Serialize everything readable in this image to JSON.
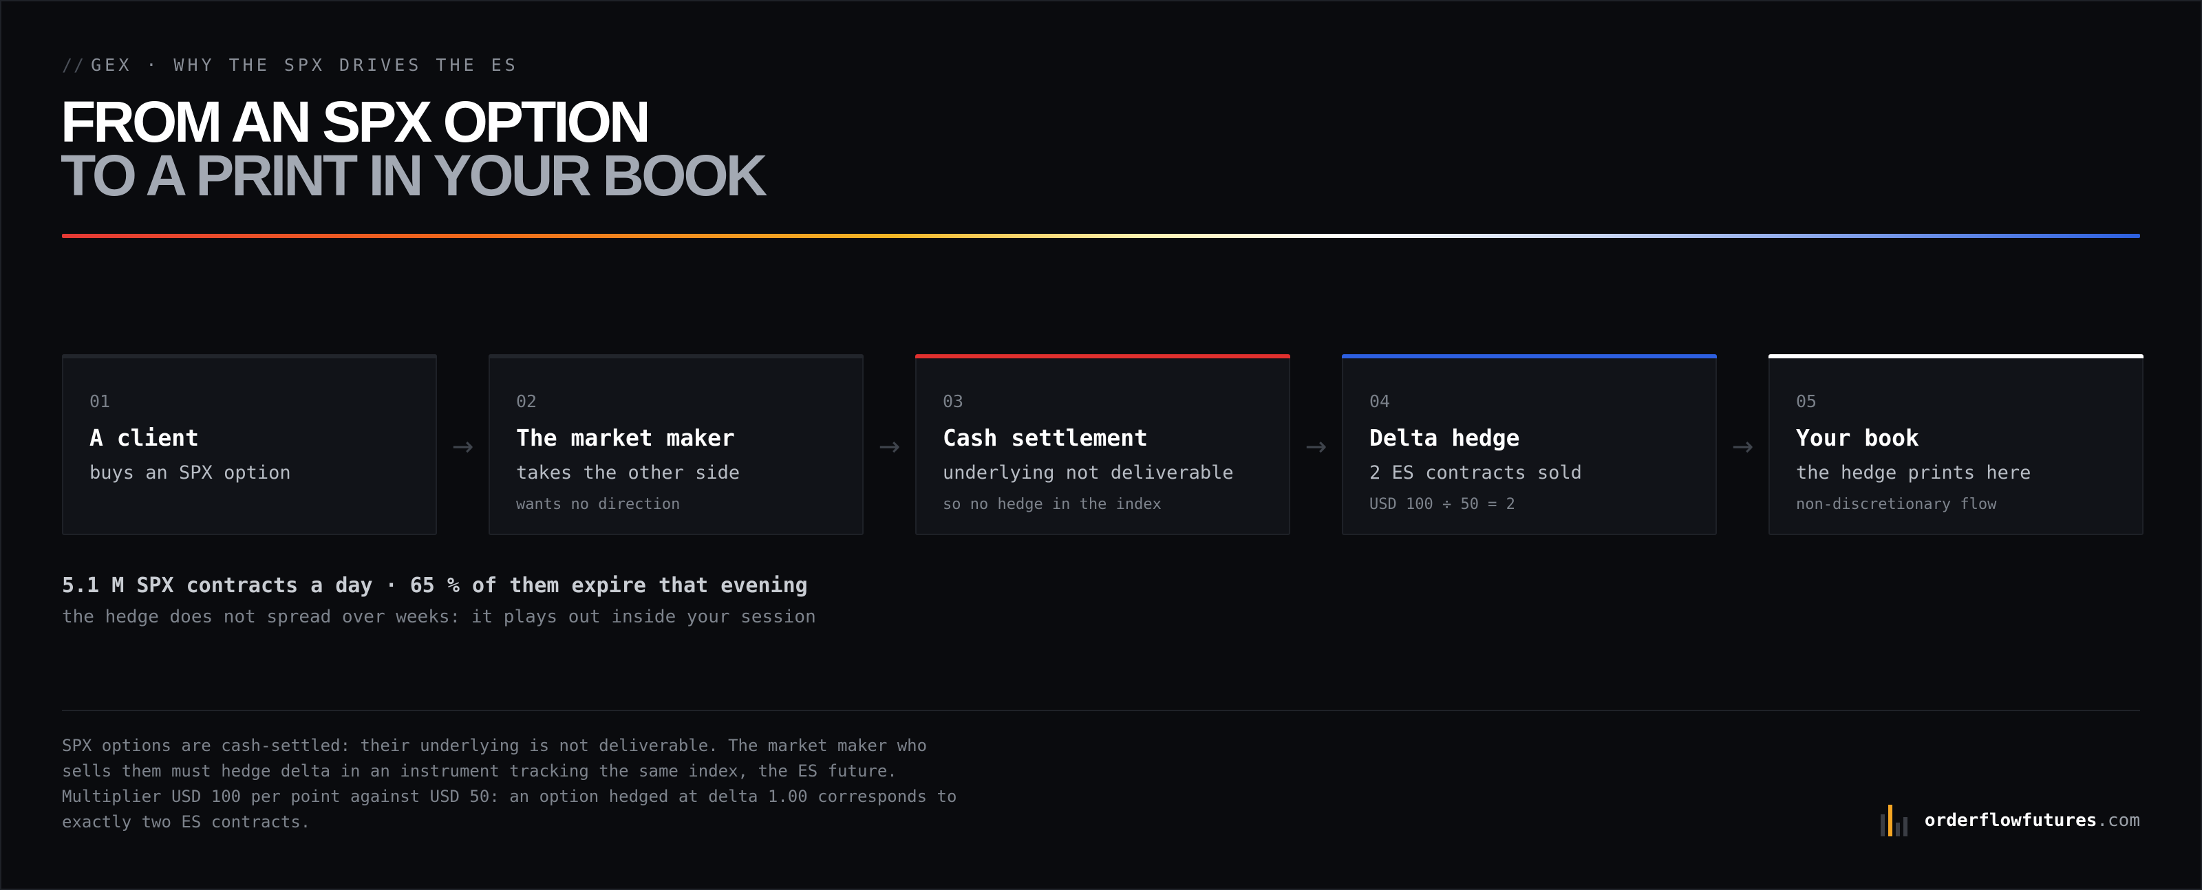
{
  "header": {
    "eyebrow_prefix": "//",
    "eyebrow": "GEX · WHY THE SPX DRIVES THE ES",
    "title_line1": "FROM AN SPX OPTION",
    "title_line2": "TO A PRINT IN YOUR BOOK",
    "rule_colors": [
      "#e53935",
      "#f06a1a",
      "#f3b625",
      "#ffffff",
      "#2c5fde"
    ]
  },
  "steps": [
    {
      "num": "01",
      "title": "A client",
      "subtitle": "buys an SPX option",
      "note": "",
      "accent": "#22252b"
    },
    {
      "num": "02",
      "title": "The market maker",
      "subtitle": "takes the other side",
      "note": "wants no direction",
      "accent": "#22252b"
    },
    {
      "num": "03",
      "title": "Cash settlement",
      "subtitle": "underlying not deliverable",
      "note": "so no hedge in the index",
      "accent": "#e0302e"
    },
    {
      "num": "04",
      "title": "Delta hedge",
      "subtitle": "2 ES contracts sold",
      "note": "USD 100 ÷ 50 = 2",
      "accent": "#2d5fe0"
    },
    {
      "num": "05",
      "title": "Your book",
      "subtitle": "the hedge prints here",
      "note": "non-discretionary flow",
      "accent": "#ffffff"
    }
  ],
  "arrow_icon": "arrow-right-icon",
  "arrow_glyph": "→",
  "stats": {
    "headline": "5.1 M SPX contracts a day · 65 % of them expire that evening",
    "sub": "the hedge does not spread over weeks: it plays out inside your session"
  },
  "footnote": [
    "SPX options are cash-settled: their underlying is not deliverable. The market maker who",
    "sells them must hedge delta in an instrument tracking the same index, the ES future.",
    "Multiplier USD 100 per point against USD 50: an option hedged at delta 1.00 corresponds to",
    "exactly two ES contracts."
  ],
  "brand": {
    "name": "orderflowfutures",
    "tld": ".com",
    "logo_colors": [
      "#3a3d44",
      "#f5a623",
      "#3a3d44",
      "#3a3d44"
    ]
  }
}
